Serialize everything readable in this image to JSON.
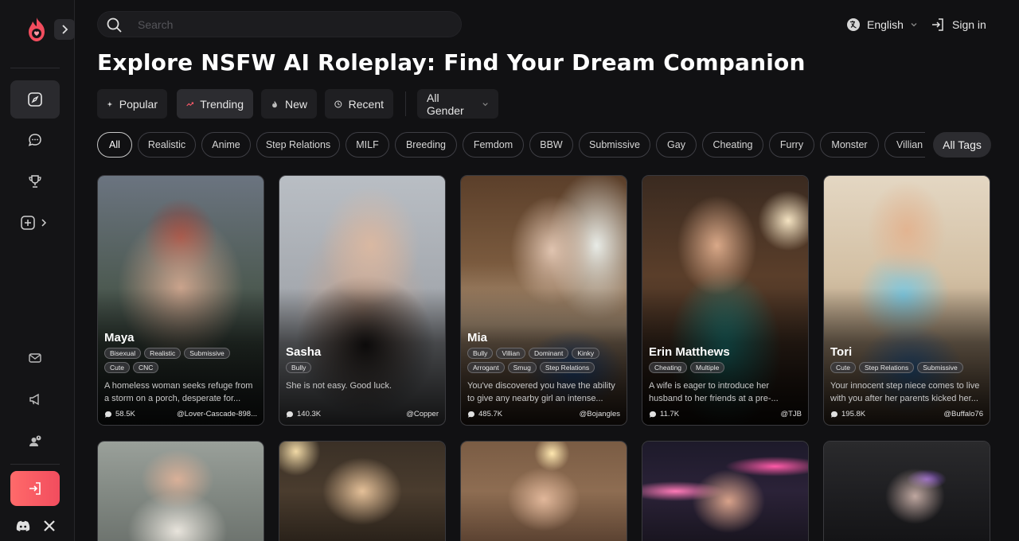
{
  "search": {
    "placeholder": "Search"
  },
  "header": {
    "language": "English",
    "sign_in": "Sign in"
  },
  "page_title": "Explore NSFW AI Roleplay: Find Your Dream Companion",
  "sort_options": [
    {
      "label": "Popular",
      "icon": "sparkle-icon"
    },
    {
      "label": "Trending",
      "icon": "trend-icon"
    },
    {
      "label": "New",
      "icon": "flame-icon"
    },
    {
      "label": "Recent",
      "icon": "clock-icon"
    }
  ],
  "gender_filter": {
    "selected": "All Gender"
  },
  "tags": [
    "All",
    "Realistic",
    "Anime",
    "Step Relations",
    "MILF",
    "Breeding",
    "Femdom",
    "BBW",
    "Submissive",
    "Gay",
    "Cheating",
    "Furry",
    "Monster",
    "Villian"
  ],
  "all_tags_label": "All Tags",
  "cards": [
    {
      "name": "Maya",
      "tags": [
        "Bisexual",
        "Realistic",
        "Submissive",
        "Cute",
        "CNC"
      ],
      "desc": "A homeless woman seeks refuge from a storm on a porch, desperate for...",
      "count": "58.5K",
      "author": "@Lover-Cascade-898..."
    },
    {
      "name": "Sasha",
      "tags": [
        "Bully"
      ],
      "desc": "She is not easy. Good luck.",
      "count": "140.3K",
      "author": "@Copper"
    },
    {
      "name": "Mia",
      "tags": [
        "Bully",
        "Villian",
        "Dominant",
        "Kinky",
        "Arrogant",
        "Smug",
        "Step Relations"
      ],
      "desc": "You've discovered you have the ability to give any nearby girl an intense...",
      "count": "485.7K",
      "author": "@Bojangles"
    },
    {
      "name": "Erin Matthews",
      "tags": [
        "Cheating",
        "Multiple"
      ],
      "desc": "A wife is eager to introduce her husband to her friends at a pre-...",
      "count": "11.7K",
      "author": "@TJB"
    },
    {
      "name": "Tori",
      "tags": [
        "Cute",
        "Step Relations",
        "Submissive"
      ],
      "desc": "Your innocent step niece comes to live with you after her parents kicked her...",
      "count": "195.8K",
      "author": "@Buffalo76"
    }
  ],
  "colors": {
    "accent": "#f24d5e",
    "background": "#111113",
    "sidebar": "#141416"
  }
}
